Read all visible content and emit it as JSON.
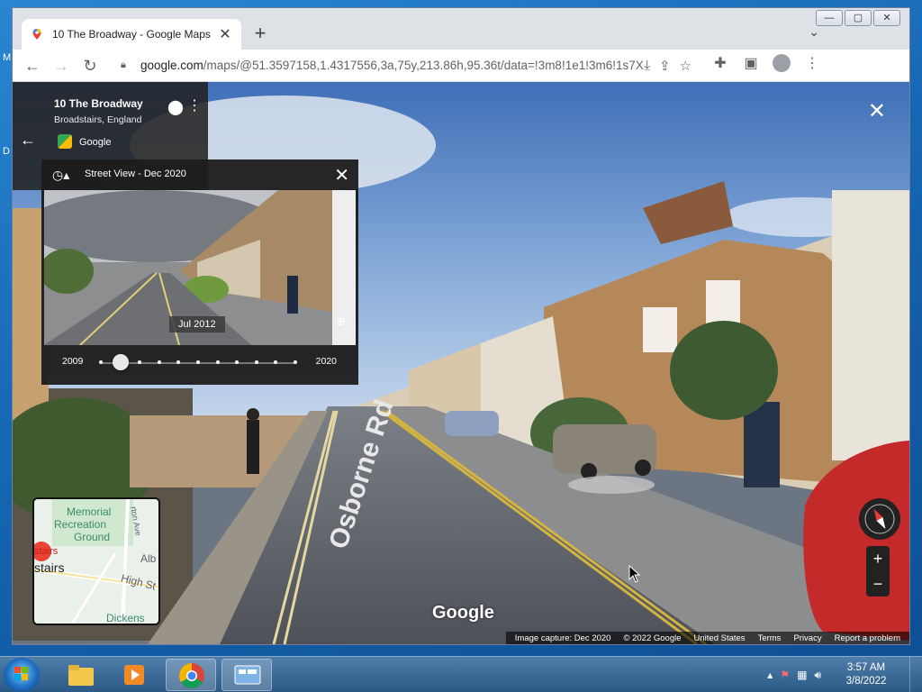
{
  "desktop": {
    "side_letters": [
      "M",
      "D"
    ]
  },
  "browser": {
    "tab_title": "10 The Broadway - Google Maps",
    "tab_close": "✕",
    "new_tab": "+",
    "url_host": "google.com",
    "url_path": "/maps/@51.3597158,1.4317556,3a,75y,213.86h,95.36t/data=!3m8!1e1!3m6!1s7Xb_sY...",
    "window_controls": [
      "—",
      "▢",
      "✕"
    ]
  },
  "place": {
    "name": "10 The Broadway",
    "subtitle": "Broadstairs, England",
    "provider": "Google"
  },
  "timeline": {
    "title": "Street View - Dec 2020",
    "selected_date": "Jul 2012",
    "start_year": "2009",
    "end_year": "2020",
    "points": 11,
    "selected_index": 1
  },
  "minimap": {
    "labels": [
      "Memorial",
      "Recreation",
      "Ground",
      "stairs",
      "stairs",
      "High St",
      "Alb",
      "rton Ave",
      "Dickens"
    ]
  },
  "street_label": "Osborne Rd",
  "logo_text": "Google",
  "zoom": {
    "plus": "+",
    "minus": "−"
  },
  "footer": [
    "Image capture: Dec 2020",
    "© 2022 Google",
    "United States",
    "Terms",
    "Privacy",
    "Report a problem"
  ],
  "taskbar": {
    "time": "3:57 AM",
    "date": "3/8/2022"
  }
}
